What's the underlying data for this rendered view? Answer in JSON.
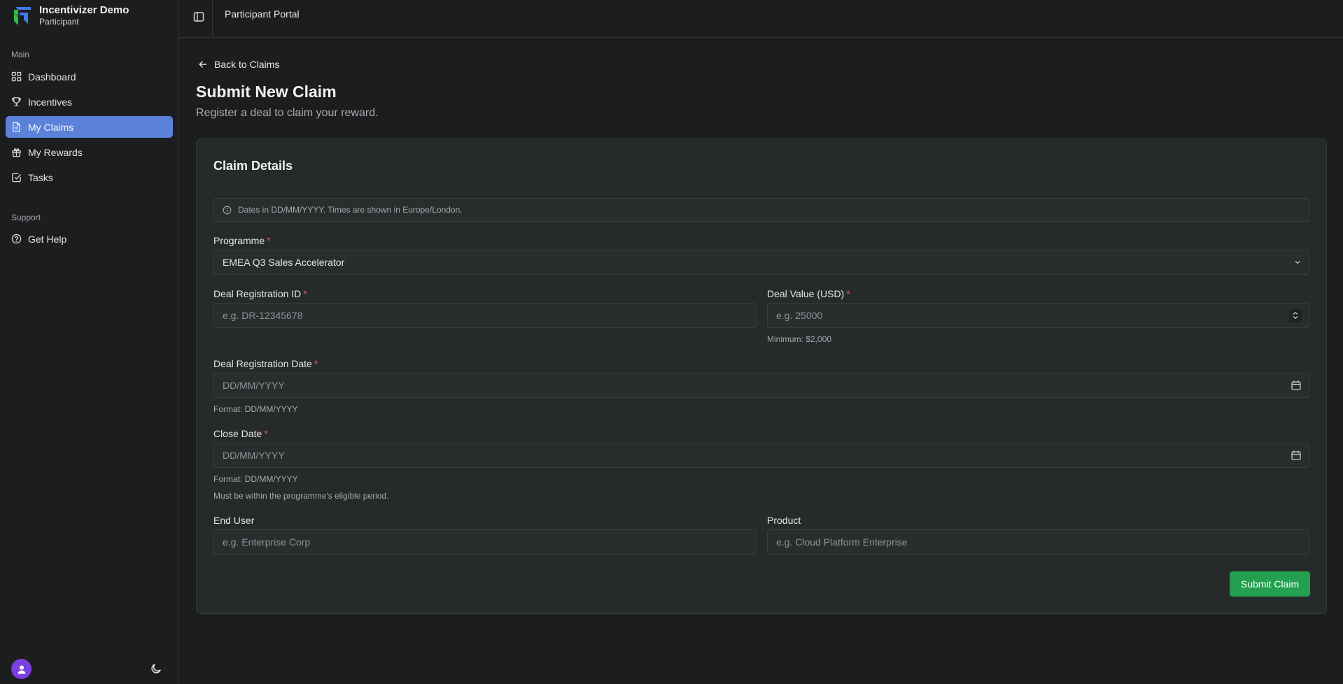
{
  "brand": {
    "title": "Incentivizer Demo",
    "subtitle": "Participant"
  },
  "sidebar": {
    "sections": [
      {
        "label": "Main"
      },
      {
        "label": "Support"
      }
    ],
    "items": [
      {
        "label": "Dashboard",
        "icon": "dashboard-icon"
      },
      {
        "label": "Incentives",
        "icon": "trophy-icon"
      },
      {
        "label": "My Claims",
        "icon": "document-icon",
        "active": true
      },
      {
        "label": "My Rewards",
        "icon": "gift-icon"
      },
      {
        "label": "Tasks",
        "icon": "checkbox-icon"
      },
      {
        "label": "Get Help",
        "icon": "help-circle-icon"
      }
    ]
  },
  "header": {
    "title": "Participant Portal"
  },
  "main": {
    "back_label": "Back to Claims",
    "title": "Submit New Claim",
    "subtitle": "Register a deal to claim your reward."
  },
  "form": {
    "card_title": "Claim Details",
    "info": "Dates in DD/MM/YYYY. Times are shown in Europe/London.",
    "required_mark": "*",
    "programme": {
      "label": "Programme",
      "value": "EMEA Q3 Sales Accelerator"
    },
    "deal_id": {
      "label": "Deal Registration ID",
      "placeholder": "e.g. DR-12345678"
    },
    "deal_value": {
      "label": "Deal Value (USD)",
      "placeholder": "e.g. 25000",
      "help": "Minimum: $2,000"
    },
    "reg_date": {
      "label": "Deal Registration Date",
      "placeholder": "DD/MM/YYYY",
      "help": "Format: DD/MM/YYYY"
    },
    "close_date": {
      "label": "Close Date",
      "placeholder": "DD/MM/YYYY",
      "help": "Format: DD/MM/YYYY",
      "help2": "Must be within the programme's eligible period."
    },
    "end_user": {
      "label": "End User",
      "placeholder": "e.g. Enterprise Corp"
    },
    "product": {
      "label": "Product",
      "placeholder": "e.g. Cloud Platform Enterprise"
    },
    "submit_label": "Submit Claim"
  },
  "colors": {
    "accent": "#5a82d8",
    "submit": "#22a04f",
    "required": "#e05d5d",
    "avatar": "#7b3fe0"
  }
}
